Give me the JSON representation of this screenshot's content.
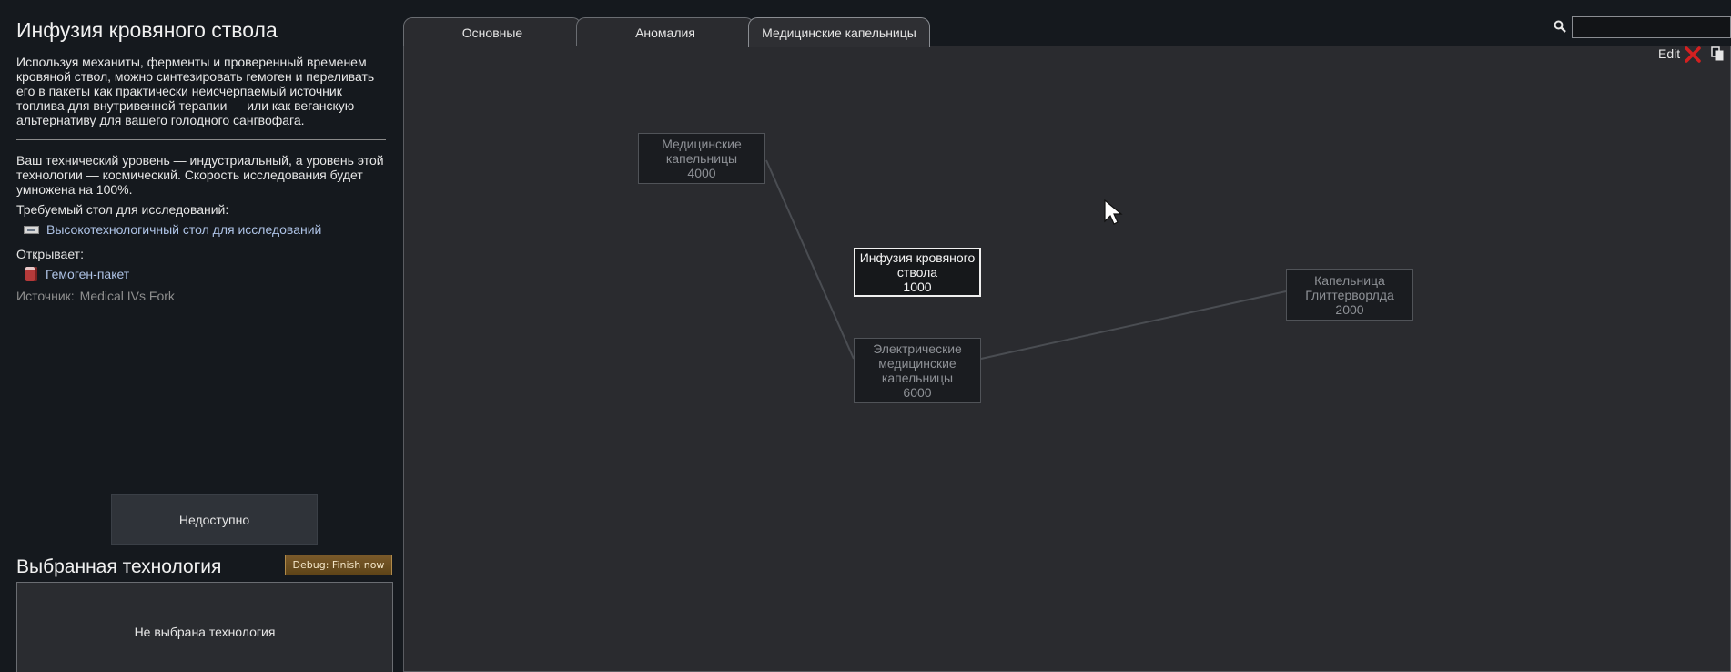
{
  "left": {
    "title": "Инфузия кровяного ствола",
    "description": "Используя механиты, ферменты и проверенный временем кровяной ствол, можно синтезировать гемоген и переливать его в пакеты как практически неисчерпаемый источник топлива для внутривенной терапии — или как веганскую альтернативу для вашего голодного сангвофага.",
    "tech_level": "Ваш технический уровень — индустриальный, а уровень этой технологии — космический. Скорость исследования будет умножена на 100%.",
    "bench_label": "Требуемый стол для исследований:",
    "bench": "Высокотехнологичный стол для исследований",
    "unlocks_label": "Открывает:",
    "unlock_item": "Гемоген-пакет",
    "source_label": "Источник:",
    "source_value": "Medical IVs Fork",
    "unavailable_button": "Недоступно",
    "selected_title": "Выбранная технология",
    "debug_button": "Debug: Finish now",
    "no_selection": "Не выбрана технология"
  },
  "tabs": [
    {
      "label": "Основные",
      "active": false
    },
    {
      "label": "Аномалия",
      "active": false
    },
    {
      "label": "Медицинские капельницы",
      "active": true
    }
  ],
  "toolbar": {
    "search_value": "",
    "edit_label": "Edit"
  },
  "nodes": {
    "medical_drips": {
      "name": "Медицинские капельницы",
      "cost": "4000"
    },
    "hemogen_infusion": {
      "name": "Инфузия кровяного ствола",
      "cost": "1000"
    },
    "electric_drips": {
      "name": "Электрические медицинские капельницы",
      "cost": "6000"
    },
    "glitterworld_drip": {
      "name": "Капельница Глиттерворлда",
      "cost": "2000"
    }
  },
  "colors": {
    "accent_close": "#d42020",
    "link_text": "#aec3e6",
    "debug_bg": "#6b4e20"
  }
}
